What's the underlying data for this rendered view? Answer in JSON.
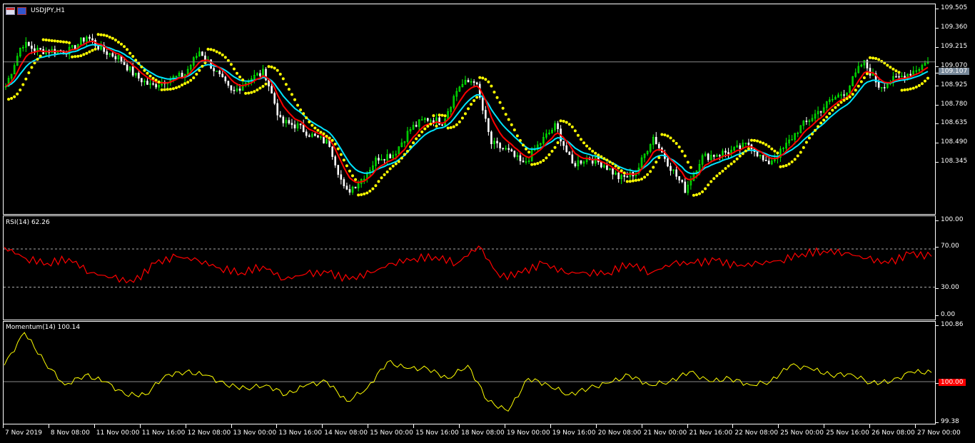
{
  "symbol_label": "USDJPY,H1",
  "icons": [
    "chart-window-icon",
    "save-icon"
  ],
  "colors": {
    "bull": "#00ff00",
    "bear": "#ffffff",
    "sar": "#ffff00",
    "ma_fast": "#ff0000",
    "ma_slow": "#00e5ff",
    "rsi": "#ff0000",
    "momentum": "#ffff00",
    "bid_tag": "#778899",
    "mom_tag": "#ff0000"
  },
  "price_axis": {
    "ticks": [
      "109.505",
      "109.360",
      "109.215",
      "109.070",
      "108.925",
      "108.780",
      "108.635",
      "108.490",
      "108.345"
    ],
    "current": "109.107"
  },
  "rsi": {
    "label": "RSI(14) 62.26",
    "ticks": [
      "100.00",
      "70.00",
      "30.00",
      "0.00"
    ]
  },
  "momentum": {
    "label": "Momentum(14) 100.14",
    "ticks": [
      "100.86",
      "99.38"
    ],
    "current": "100.00"
  },
  "time_axis": [
    "7 Nov 2019",
    "8 Nov 08:00",
    "11 Nov 00:00",
    "11 Nov 16:00",
    "12 Nov 08:00",
    "13 Nov 00:00",
    "13 Nov 16:00",
    "14 Nov 08:00",
    "15 Nov 00:00",
    "15 Nov 16:00",
    "18 Nov 08:00",
    "19 Nov 00:00",
    "19 Nov 16:00",
    "20 Nov 08:00",
    "21 Nov 00:00",
    "21 Nov 16:00",
    "22 Nov 08:00",
    "25 Nov 00:00",
    "25 Nov 16:00",
    "26 Nov 08:00",
    "27 Nov 00:00"
  ],
  "chart_data": [
    {
      "type": "line",
      "title": "USDJPY,H1 close (approx.)",
      "ylim": [
        107.96,
        109.54
      ],
      "closes": [
        108.922,
        109.246,
        109.192,
        109.192,
        109.192,
        109.3,
        109.192,
        109.138,
        109.003,
        108.922,
        108.976,
        109.003,
        109.192,
        109.03,
        108.868,
        108.976,
        109.03,
        108.652,
        108.625,
        108.544,
        108.49,
        108.113,
        108.221,
        108.383,
        108.41,
        108.598,
        108.679,
        108.652,
        108.922,
        108.976,
        108.49,
        108.436,
        108.329,
        108.49,
        108.625,
        108.329,
        108.383,
        108.329,
        108.221,
        108.275,
        108.544,
        108.329,
        108.14,
        108.383,
        108.41,
        108.436,
        108.49,
        108.329,
        108.436,
        108.598,
        108.706,
        108.814,
        108.895,
        109.11,
        108.922,
        108.976,
        109.03,
        109.107
      ]
    },
    {
      "type": "line",
      "title": "RSI(14)",
      "ylim": [
        0,
        100
      ],
      "levels": [
        70,
        30
      ],
      "values": [
        72,
        60,
        55,
        60,
        45,
        40,
        35,
        55,
        62,
        58,
        50,
        45,
        52,
        38,
        44,
        45,
        38,
        45,
        55,
        60,
        62,
        55,
        73,
        40,
        45,
        55,
        45,
        45,
        45,
        55,
        45,
        55,
        55,
        58,
        52,
        55,
        58,
        65,
        68,
        66,
        60,
        55,
        65,
        62.26
      ]
    },
    {
      "type": "line",
      "title": "Momentum(14)",
      "ylim": [
        99.38,
        100.86
      ],
      "level": 100,
      "values": [
        100.25,
        100.75,
        100.3,
        99.95,
        100.1,
        100,
        99.8,
        99.8,
        100.1,
        100.15,
        100.1,
        99.95,
        99.9,
        99.95,
        99.8,
        99.95,
        100,
        99.7,
        99.9,
        100.3,
        100.2,
        100.2,
        100.05,
        100.25,
        99.7,
        99.55,
        100.05,
        99.95,
        99.8,
        99.9,
        99.98,
        100.1,
        99.95,
        100,
        100.15,
        100,
        100.05,
        99.95,
        100,
        100.25,
        100.2,
        100.1,
        100.12,
        99.98,
        100,
        100.15,
        100.14
      ]
    }
  ]
}
